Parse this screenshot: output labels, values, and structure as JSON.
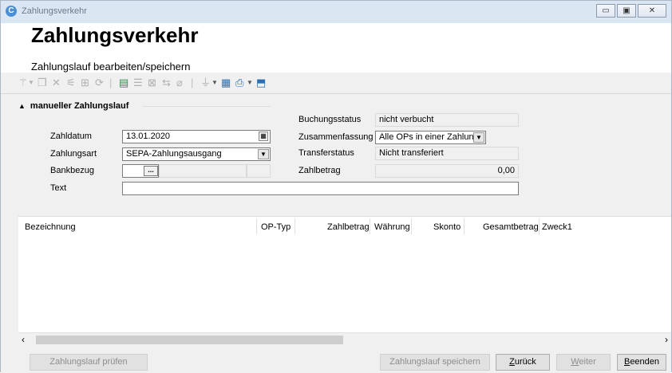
{
  "window": {
    "title": "Zahlungsverkehr",
    "controls": {
      "minimize": "▭",
      "maximize": "▣",
      "close": "✕"
    }
  },
  "header": {
    "title": "Zahlungsverkehr",
    "subtitle": "Zahlungslauf bearbeiten/speichern"
  },
  "toolbar": {
    "icons": [
      "wand-icon",
      "copy-icon",
      "delete-icon",
      "filter-edit-icon",
      "split-icon",
      "refresh-icon",
      "add-record-icon",
      "list-icon",
      "remove-record-icon",
      "transfer-icon",
      "eraser-icon",
      "filter-icon",
      "export-icon",
      "print-icon",
      "exit-icon"
    ]
  },
  "group": {
    "title": "manueller Zahlungslauf"
  },
  "form": {
    "zahldatum_label": "Zahldatum",
    "zahldatum_value": "13.01.2020",
    "zahlungsart_label": "Zahlungsart",
    "zahlungsart_value": "SEPA-Zahlungsausgang",
    "bankbezug_label": "Bankbezug",
    "bankbezug_button": "...",
    "text_label": "Text",
    "text_value": "",
    "buchungsstatus_label": "Buchungsstatus",
    "buchungsstatus_value": "nicht verbucht",
    "zusammenfassung_label": "Zusammenfassung",
    "zusammenfassung_value": "Alle OPs in einer Zahlung",
    "transferstatus_label": "Transferstatus",
    "transferstatus_value": "Nicht transferiert",
    "zahlbetrag_label": "Zahlbetrag",
    "zahlbetrag_value": "0,00"
  },
  "grid": {
    "columns": [
      "Bezeichnung",
      "OP-Typ",
      "Zahlbetrag",
      "Währung",
      "Skonto",
      "Gesamtbetrag",
      "Zweck1"
    ],
    "rows": []
  },
  "footer": {
    "pruefen": "Zahlungslauf prüfen",
    "speichern": "Zahlungslauf speichern",
    "zurueck_u": "Z",
    "zurueck_rest": "urück",
    "weiter_u": "W",
    "weiter_rest": "eiter",
    "beenden_u": "B",
    "beenden_rest": "eenden"
  }
}
